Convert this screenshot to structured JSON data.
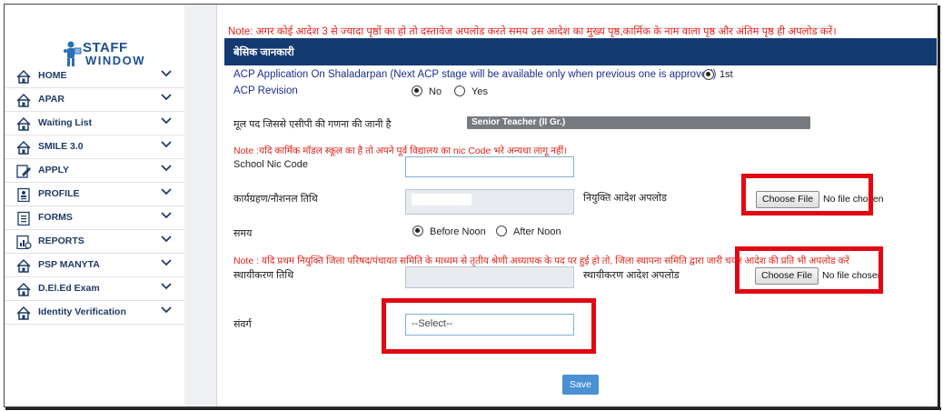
{
  "brand": {
    "line1": "STAFF",
    "line2": "WINDOW"
  },
  "sidebar": {
    "items": [
      {
        "label": "HOME",
        "icon": "home-icon"
      },
      {
        "label": "APAR",
        "icon": "home-icon"
      },
      {
        "label": "Waiting List",
        "icon": "home-icon"
      },
      {
        "label": "SMILE 3.0",
        "icon": "home-icon"
      },
      {
        "label": "APPLY",
        "icon": "edit-icon"
      },
      {
        "label": "PROFILE",
        "icon": "profile-icon"
      },
      {
        "label": "FORMS",
        "icon": "forms-icon"
      },
      {
        "label": "REPORTS",
        "icon": "reports-icon"
      },
      {
        "label": "PSP MANYTA",
        "icon": "home-icon"
      },
      {
        "label": "D.El.Ed Exam",
        "icon": "home-icon"
      },
      {
        "label": "Identity Verification",
        "icon": "home-icon"
      }
    ]
  },
  "form": {
    "top_note": "Note: अगर कोई आदेश 3 से ज्यादा पृष्ठों का हो तो दस्तावेज अपलोड करते समय उस आदेश का मुख्य पृष्ठ,कार्मिक के नाम वाला पृष्ठ और अंतिम पृष्ठ ही अपलोड करें।",
    "section_title": "बेसिक जानकारी",
    "acp_label": "ACP Application On Shaladarpan (Next ACP stage will be available only when previous one is approved)",
    "acp_option": "1st",
    "revision_label": "ACP Revision",
    "revision_no": "No",
    "revision_yes": "Yes",
    "post_label": "मूल पद जिससे एसीपी की गणना की जानी है",
    "post_value": "Senior Teacher (II Gr.)",
    "nic_note": "Note :यदि कार्मिक मॉडल स्कूल का है तो अपने पूर्व विद्यालय का nic Code भरे अन्यथा लागू नहीं।",
    "nic_label": "School Nic Code",
    "joining_label": "कार्यग्रहण/नौशनल तिथि",
    "appointment_upload_label": "नियुक्ति आदेश अपलोड",
    "time_label": "समय",
    "time_before": "Before Noon",
    "time_after": "After Noon",
    "zila_note": "Note : यदि प्रथम नियुक्ति जिला परिषद/पंचायत समिति के माध्यम से तृतीय श्रेणी अध्यापक के पद पर हुई हो तो, जिला स्थापना समिति द्वारा जारी चयन आदेश की प्रति भी अपलोड करें",
    "confirm_label": "स्थायीकरण तिथि",
    "confirm_upload_label": "स्थायीकरण आदेश अपलोड",
    "cadre_label": "संवर्ग",
    "cadre_placeholder": "--Select--",
    "choose_file": "Choose File",
    "no_file_1": "No file chosen",
    "no_file_2": "No file chosen",
    "save": "Save"
  },
  "colors": {
    "header": "#143a72",
    "note": "#e0241b",
    "highlight": "#e30613",
    "save": "#4a90d4"
  }
}
